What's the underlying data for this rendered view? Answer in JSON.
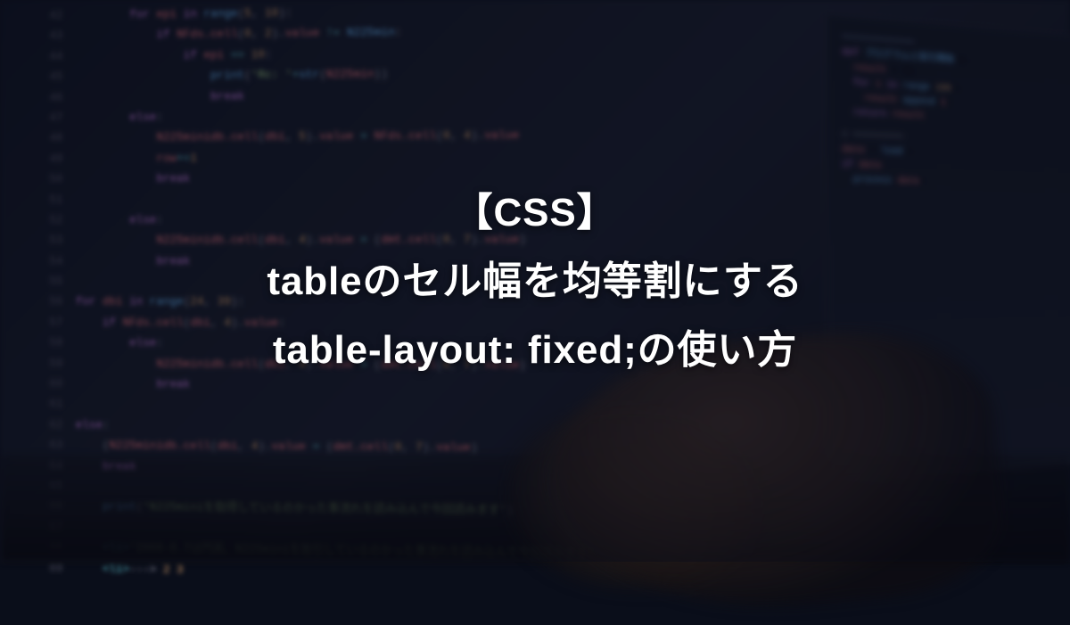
{
  "title": {
    "line1": "【CSS】",
    "line2": "tableのセル幅を均等割にする",
    "line3": "table-layout: fixed;の使い方"
  },
  "background_code": {
    "lines": [
      {
        "indent": 2,
        "content": [
          {
            "t": "kw",
            "v": "for"
          },
          {
            "t": "",
            "v": " "
          },
          {
            "t": "var",
            "v": "epi"
          },
          {
            "t": "",
            "v": " "
          },
          {
            "t": "kw",
            "v": "in"
          },
          {
            "t": "",
            "v": " "
          },
          {
            "t": "fn",
            "v": "range"
          },
          {
            "t": "",
            "v": "("
          },
          {
            "t": "num",
            "v": "5"
          },
          {
            "t": "",
            "v": ", "
          },
          {
            "t": "num",
            "v": "10"
          },
          {
            "t": "",
            "v": "):"
          }
        ]
      },
      {
        "indent": 3,
        "content": [
          {
            "t": "kw",
            "v": "if"
          },
          {
            "t": "",
            "v": " "
          },
          {
            "t": "var",
            "v": "NFds.cell"
          },
          {
            "t": "",
            "v": "("
          },
          {
            "t": "num",
            "v": "0"
          },
          {
            "t": "",
            "v": ", "
          },
          {
            "t": "num",
            "v": "2"
          },
          {
            "t": "",
            "v": ")."
          },
          {
            "t": "var",
            "v": "value"
          },
          {
            "t": "",
            "v": " "
          },
          {
            "t": "op",
            "v": "!="
          },
          {
            "t": "",
            "v": " "
          },
          {
            "t": "fn",
            "v": "N225min"
          },
          {
            "t": "",
            "v": ":"
          }
        ]
      },
      {
        "indent": 4,
        "content": [
          {
            "t": "kw",
            "v": "if"
          },
          {
            "t": "",
            "v": " "
          },
          {
            "t": "var",
            "v": "epi"
          },
          {
            "t": "",
            "v": " "
          },
          {
            "t": "op",
            "v": "=="
          },
          {
            "t": "",
            "v": " "
          },
          {
            "t": "num",
            "v": "10"
          },
          {
            "t": "",
            "v": ":"
          }
        ]
      },
      {
        "indent": 5,
        "content": [
          {
            "t": "fn",
            "v": "print"
          },
          {
            "t": "",
            "v": "("
          },
          {
            "t": "str",
            "v": "'Rc: '"
          },
          {
            "t": "op",
            "v": "+"
          },
          {
            "t": "fn",
            "v": "str"
          },
          {
            "t": "",
            "v": "("
          },
          {
            "t": "var",
            "v": "N225min"
          },
          {
            "t": "",
            "v": "))"
          }
        ]
      },
      {
        "indent": 5,
        "content": [
          {
            "t": "kw",
            "v": "break"
          }
        ]
      },
      {
        "indent": 2,
        "content": [
          {
            "t": "kw",
            "v": "else"
          },
          {
            "t": "",
            "v": ":"
          }
        ]
      },
      {
        "indent": 3,
        "content": [
          {
            "t": "var",
            "v": "N225minidb.cell"
          },
          {
            "t": "",
            "v": "("
          },
          {
            "t": "var",
            "v": "dbi"
          },
          {
            "t": "",
            "v": ", "
          },
          {
            "t": "num",
            "v": "5"
          },
          {
            "t": "",
            "v": ")."
          },
          {
            "t": "var",
            "v": "value"
          },
          {
            "t": "",
            "v": " "
          },
          {
            "t": "op",
            "v": "="
          },
          {
            "t": "",
            "v": " "
          },
          {
            "t": "var",
            "v": "NFds.cell"
          },
          {
            "t": "",
            "v": "("
          },
          {
            "t": "num",
            "v": "0"
          },
          {
            "t": "",
            "v": ", "
          },
          {
            "t": "num",
            "v": "4"
          },
          {
            "t": "",
            "v": ")."
          },
          {
            "t": "var",
            "v": "value"
          }
        ]
      },
      {
        "indent": 3,
        "content": [
          {
            "t": "var",
            "v": "row"
          },
          {
            "t": "op",
            "v": "+="
          },
          {
            "t": "num",
            "v": "1"
          }
        ]
      },
      {
        "indent": 3,
        "content": [
          {
            "t": "kw",
            "v": "break"
          }
        ]
      },
      {
        "indent": 0,
        "content": []
      },
      {
        "indent": 2,
        "content": [
          {
            "t": "kw",
            "v": "else"
          },
          {
            "t": "",
            "v": ":"
          }
        ]
      },
      {
        "indent": 3,
        "content": [
          {
            "t": "var",
            "v": "N225minidb.cell"
          },
          {
            "t": "",
            "v": "("
          },
          {
            "t": "var",
            "v": "dbi"
          },
          {
            "t": "",
            "v": ", "
          },
          {
            "t": "num",
            "v": "4"
          },
          {
            "t": "",
            "v": ")."
          },
          {
            "t": "var",
            "v": "value"
          },
          {
            "t": "",
            "v": " "
          },
          {
            "t": "op",
            "v": "="
          },
          {
            "t": "",
            "v": " ("
          },
          {
            "t": "var",
            "v": "dmt.cell"
          },
          {
            "t": "",
            "v": "("
          },
          {
            "t": "num",
            "v": "0"
          },
          {
            "t": "",
            "v": ", "
          },
          {
            "t": "num",
            "v": "7"
          },
          {
            "t": "",
            "v": ")."
          },
          {
            "t": "var",
            "v": "value"
          },
          {
            "t": "",
            "v": ")"
          }
        ]
      },
      {
        "indent": 3,
        "content": [
          {
            "t": "kw",
            "v": "break"
          }
        ]
      },
      {
        "indent": 0,
        "content": []
      },
      {
        "indent": 0,
        "content": [
          {
            "t": "kw",
            "v": "for"
          },
          {
            "t": "",
            "v": " "
          },
          {
            "t": "var",
            "v": "dbi"
          },
          {
            "t": "",
            "v": " "
          },
          {
            "t": "kw",
            "v": "in"
          },
          {
            "t": "",
            "v": " "
          },
          {
            "t": "fn",
            "v": "range"
          },
          {
            "t": "",
            "v": "("
          },
          {
            "t": "num",
            "v": "24"
          },
          {
            "t": "",
            "v": ", "
          },
          {
            "t": "num",
            "v": "39"
          },
          {
            "t": "",
            "v": "):"
          }
        ]
      },
      {
        "indent": 1,
        "content": [
          {
            "t": "kw",
            "v": "if"
          },
          {
            "t": "",
            "v": " "
          },
          {
            "t": "var",
            "v": "NFds.cell"
          },
          {
            "t": "",
            "v": "("
          },
          {
            "t": "var",
            "v": "dbi"
          },
          {
            "t": "",
            "v": ", "
          },
          {
            "t": "num",
            "v": "4"
          },
          {
            "t": "",
            "v": ")."
          },
          {
            "t": "var",
            "v": "value"
          },
          {
            "t": "",
            "v": ":"
          }
        ]
      },
      {
        "indent": 2,
        "content": [
          {
            "t": "kw",
            "v": "else"
          },
          {
            "t": "",
            "v": ":"
          }
        ]
      },
      {
        "indent": 3,
        "content": [
          {
            "t": "var",
            "v": "N225minidb.cell"
          },
          {
            "t": "",
            "v": "("
          },
          {
            "t": "var",
            "v": "dbi"
          },
          {
            "t": "",
            "v": ", "
          },
          {
            "t": "num",
            "v": "4"
          },
          {
            "t": "",
            "v": ")."
          },
          {
            "t": "var",
            "v": "value"
          },
          {
            "t": "",
            "v": " "
          },
          {
            "t": "op",
            "v": "="
          },
          {
            "t": "",
            "v": " ("
          },
          {
            "t": "var",
            "v": "dmt.cell"
          },
          {
            "t": "",
            "v": "("
          },
          {
            "t": "num",
            "v": "0"
          },
          {
            "t": "",
            "v": ", "
          },
          {
            "t": "num",
            "v": "7"
          },
          {
            "t": "",
            "v": ")."
          },
          {
            "t": "var",
            "v": "value"
          },
          {
            "t": "",
            "v": ")"
          }
        ]
      },
      {
        "indent": 3,
        "content": [
          {
            "t": "kw",
            "v": "break"
          }
        ]
      },
      {
        "indent": 0,
        "content": []
      },
      {
        "indent": 0,
        "content": [
          {
            "t": "kw",
            "v": "else"
          },
          {
            "t": "",
            "v": ":"
          }
        ]
      },
      {
        "indent": 1,
        "content": [
          {
            "t": "",
            "v": "("
          },
          {
            "t": "var",
            "v": "N225minidb.cell"
          },
          {
            "t": "",
            "v": "("
          },
          {
            "t": "var",
            "v": "dbi"
          },
          {
            "t": "",
            "v": ", "
          },
          {
            "t": "num",
            "v": "4"
          },
          {
            "t": "",
            "v": ")."
          },
          {
            "t": "var",
            "v": "value"
          },
          {
            "t": "",
            "v": " "
          },
          {
            "t": "op",
            "v": "="
          },
          {
            "t": "",
            "v": " ("
          },
          {
            "t": "var",
            "v": "dmt.cell"
          },
          {
            "t": "",
            "v": "("
          },
          {
            "t": "num",
            "v": "0"
          },
          {
            "t": "",
            "v": ", "
          },
          {
            "t": "num",
            "v": "7"
          },
          {
            "t": "",
            "v": ")."
          },
          {
            "t": "var",
            "v": "value"
          },
          {
            "t": "",
            "v": ")"
          }
        ]
      },
      {
        "indent": 1,
        "content": [
          {
            "t": "kw",
            "v": "break"
          }
        ]
      },
      {
        "indent": 0,
        "content": []
      },
      {
        "indent": 1,
        "content": [
          {
            "t": "fn",
            "v": "print"
          },
          {
            "t": "",
            "v": "("
          },
          {
            "t": "str",
            "v": "'N225miniを取得しているのかった事流れを読み込んで今回読みます'"
          },
          {
            "t": "",
            "v": ")"
          }
        ]
      },
      {
        "indent": 0,
        "content": []
      },
      {
        "indent": 1,
        "content": [
          {
            "t": "op",
            "v": "<li>"
          },
          {
            "t": "str",
            "v": "'2008-8.7は円高、N225miniを取引しているのかった事流れを読み込んで今回読みます'"
          }
        ]
      },
      {
        "indent": 1,
        "content": [
          {
            "t": "op",
            "v": "<li>"
          },
          {
            "t": "",
            "v": "---> "
          },
          {
            "t": "num",
            "v": "2"
          },
          {
            "t": "",
            "v": " "
          },
          {
            "t": "num",
            "v": "3"
          }
        ]
      }
    ]
  }
}
